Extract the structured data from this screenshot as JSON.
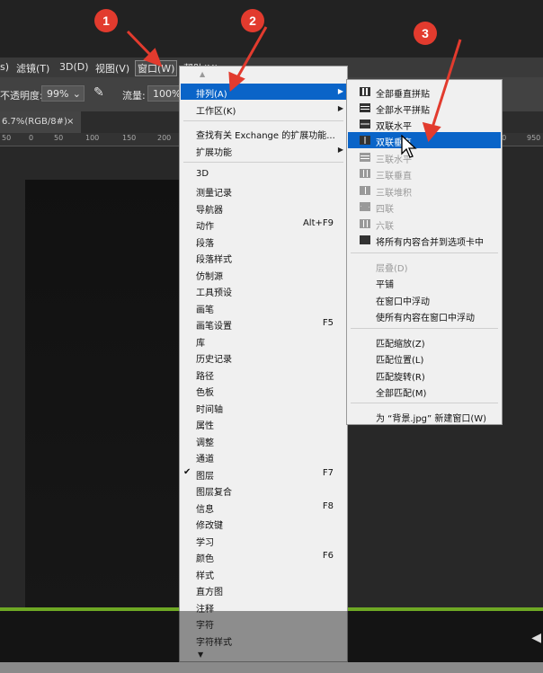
{
  "menubar": {
    "items": [
      "s)",
      "滤镜(T)",
      "3D(D)",
      "视图(V)",
      "窗口(W)",
      "帮助(H)"
    ]
  },
  "options": {
    "opacity_label": "不透明度:",
    "opacity_value": "99%",
    "flow_label": "流量:",
    "flow_value": "100%"
  },
  "tab": {
    "label": "6.7%(RGB/8#)",
    "close": "×"
  },
  "ruler": {
    "ticks": [
      "50",
      "0",
      "50",
      "100",
      "150",
      "200",
      "250",
      "900",
      "950"
    ]
  },
  "window_menu": {
    "scroll_up": "▲",
    "scroll_down": "▼",
    "items": [
      {
        "label": "排列(A)",
        "submenu": true,
        "highlighted": true
      },
      {
        "label": "工作区(K)",
        "submenu": true
      },
      {
        "label": "查找有关 Exchange 的扩展功能..."
      },
      {
        "label": "扩展功能",
        "submenu": true
      },
      {
        "label": "3D"
      },
      {
        "label": "测量记录"
      },
      {
        "label": "导航器"
      },
      {
        "label": "动作",
        "shortcut": "Alt+F9"
      },
      {
        "label": "段落"
      },
      {
        "label": "段落样式"
      },
      {
        "label": "仿制源"
      },
      {
        "label": "工具预设"
      },
      {
        "label": "画笔"
      },
      {
        "label": "画笔设置",
        "shortcut": "F5"
      },
      {
        "label": "库"
      },
      {
        "label": "历史记录"
      },
      {
        "label": "路径"
      },
      {
        "label": "色板"
      },
      {
        "label": "时间轴"
      },
      {
        "label": "属性"
      },
      {
        "label": "调整"
      },
      {
        "label": "通道"
      },
      {
        "label": "图层",
        "shortcut": "F7",
        "checked": true
      },
      {
        "label": "图层复合"
      },
      {
        "label": "信息",
        "shortcut": "F8"
      },
      {
        "label": "修改键"
      },
      {
        "label": "学习"
      },
      {
        "label": "颜色",
        "shortcut": "F6"
      },
      {
        "label": "样式"
      },
      {
        "label": "直方图"
      },
      {
        "label": "注释"
      },
      {
        "label": "字符"
      },
      {
        "label": "字符样式"
      }
    ]
  },
  "arrange_menu": {
    "items": [
      {
        "label": "全部垂直拼贴"
      },
      {
        "label": "全部水平拼贴"
      },
      {
        "label": "双联水平"
      },
      {
        "label": "双联垂直",
        "highlighted": true
      },
      {
        "label": "三联水平",
        "disabled": true
      },
      {
        "label": "三联垂直",
        "disabled": true
      },
      {
        "label": "三联堆积",
        "disabled": true
      },
      {
        "label": "四联",
        "disabled": true
      },
      {
        "label": "六联",
        "disabled": true
      },
      {
        "label": "将所有内容合并到选项卡中"
      },
      {
        "label": "层叠(D)",
        "disabled": true
      },
      {
        "label": "平铺"
      },
      {
        "label": "在窗口中浮动"
      },
      {
        "label": "使所有内容在窗口中浮动"
      },
      {
        "label": "匹配缩放(Z)"
      },
      {
        "label": "匹配位置(L)"
      },
      {
        "label": "匹配旋转(R)"
      },
      {
        "label": "全部匹配(M)"
      },
      {
        "label": "为 “背景.jpg” 新建窗口(W)"
      }
    ]
  },
  "badges": [
    "1",
    "2",
    "3"
  ],
  "colors": {
    "highlight": "#0a64c8",
    "badge": "#e23b2e",
    "arrow": "#e23b2e",
    "progress": "#6ea824"
  }
}
